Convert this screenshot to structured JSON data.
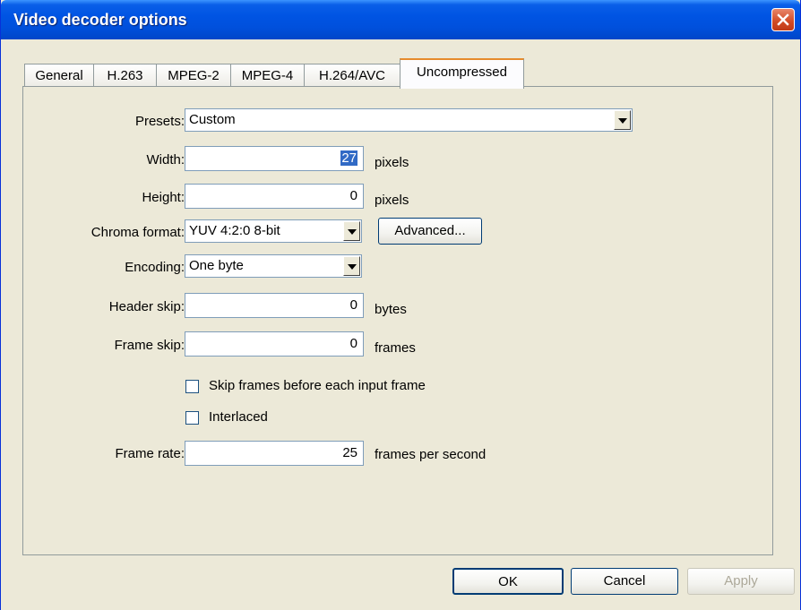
{
  "window": {
    "title": "Video decoder options",
    "close_icon": "close-icon"
  },
  "tabs": [
    {
      "label": "General"
    },
    {
      "label": "H.263"
    },
    {
      "label": "MPEG-2"
    },
    {
      "label": "MPEG-4"
    },
    {
      "label": "H.264/AVC"
    },
    {
      "label": "Uncompressed",
      "active": true
    }
  ],
  "form": {
    "presets": {
      "label": "Presets:",
      "value": "Custom"
    },
    "width": {
      "label": "Width:",
      "value": "27",
      "unit": "pixels"
    },
    "height": {
      "label": "Height:",
      "value": "0",
      "unit": "pixels"
    },
    "chroma": {
      "label": "Chroma format:",
      "value": "YUV 4:2:0 8-bit",
      "advanced_label": "Advanced..."
    },
    "encoding": {
      "label": "Encoding:",
      "value": "One byte"
    },
    "header_skip": {
      "label": "Header skip:",
      "value": "0",
      "unit": "bytes"
    },
    "frame_skip": {
      "label": "Frame skip:",
      "value": "0",
      "unit": "frames"
    },
    "skip_before": {
      "label": "Skip frames before each input frame",
      "checked": false
    },
    "interlaced": {
      "label": "Interlaced",
      "checked": false
    },
    "frame_rate": {
      "label": "Frame rate:",
      "value": "25",
      "unit": "frames per second"
    }
  },
  "buttons": {
    "ok": "OK",
    "cancel": "Cancel",
    "apply": "Apply"
  }
}
